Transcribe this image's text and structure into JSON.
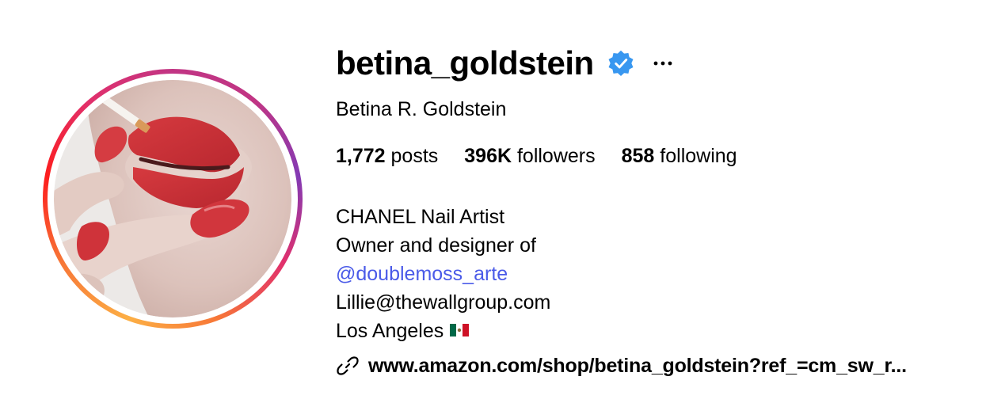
{
  "profile": {
    "username": "betina_goldstein",
    "full_name": "Betina R. Goldstein",
    "verified_icon": "verified-badge-icon",
    "more_icon": "more-options-icon"
  },
  "stats": {
    "posts_count": "1,772",
    "posts_label": " posts",
    "followers_count": "396K",
    "followers_label": " followers",
    "following_count": "858",
    "following_label": " following"
  },
  "bio": {
    "line1": "CHANEL Nail Artist",
    "line2": "Owner and designer of",
    "mention": "@doublemoss_arte",
    "email": "Lillie@thewallgroup.com",
    "location": "Los Angeles",
    "flag_icon": "mexico-flag-icon"
  },
  "link": {
    "icon": "link-icon",
    "text": "www.amazon.com/shop/betina_goldstein?ref_=cm_sw_r..."
  },
  "colors": {
    "verified_blue": "#3897f0",
    "mention_blue": "#4a5ae8",
    "text": "#000000"
  }
}
